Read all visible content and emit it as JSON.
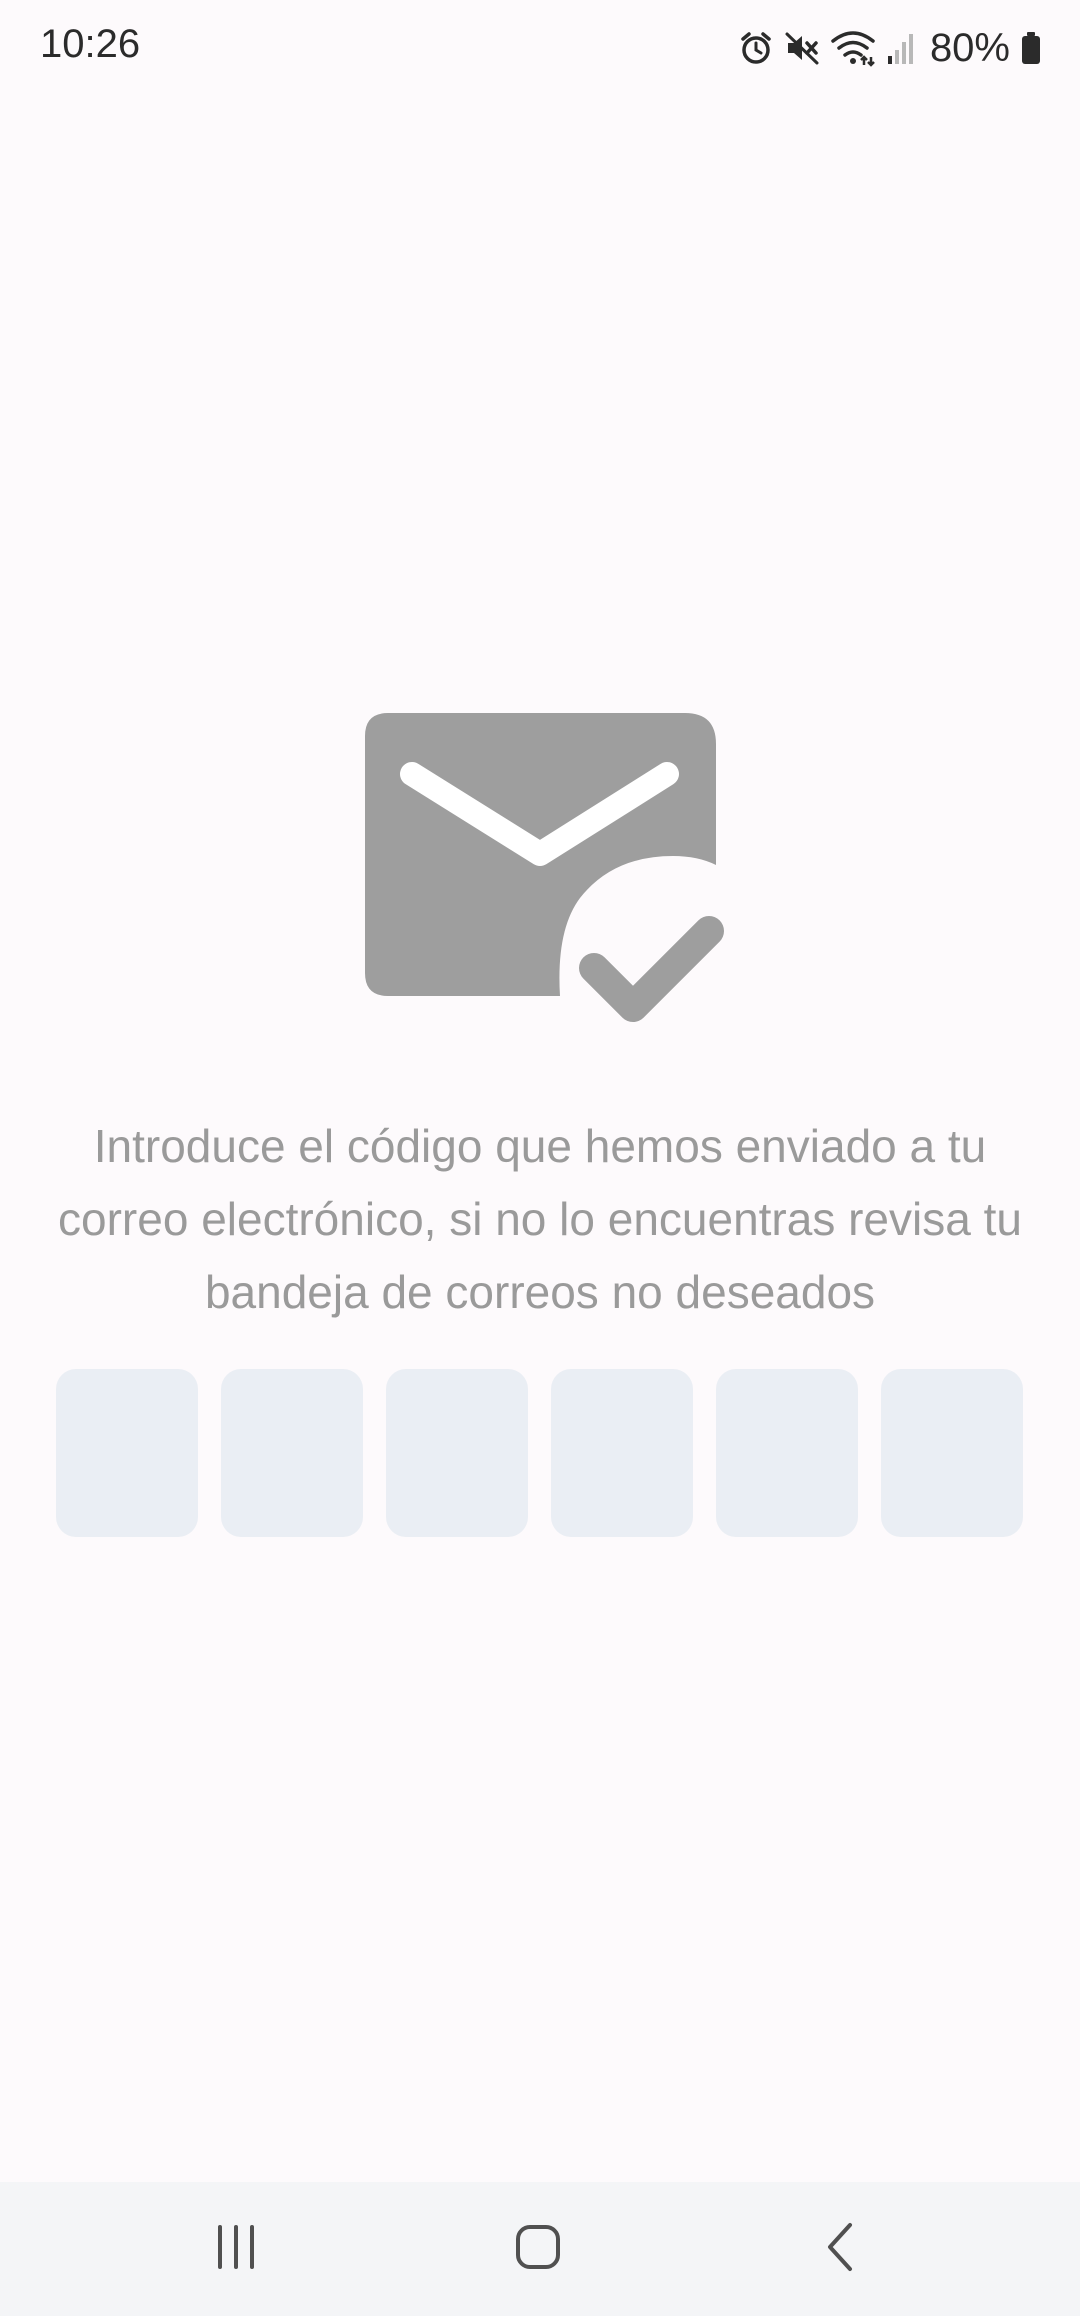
{
  "status_bar": {
    "time": "10:26",
    "battery": "80%",
    "icons": [
      "alarm-icon",
      "mute-icon",
      "wifi-icon",
      "signal-icon",
      "battery-icon"
    ]
  },
  "main": {
    "icon": "mail-check-icon",
    "instructions": "Introduce el código que hemos enviado a tu correo electrónico, si no lo encuentras revisa tu bandeja de correos no deseados",
    "code_inputs": [
      "",
      "",
      "",
      "",
      "",
      ""
    ]
  },
  "nav_bar": {
    "buttons": [
      "recent-apps-icon",
      "home-icon",
      "back-icon"
    ]
  },
  "colors": {
    "background": "#fdfafc",
    "icon_gray": "#9e9e9e",
    "text_gray": "#9a9a9a",
    "input_bg": "#eaeef4",
    "nav_bg": "#f4f5f7"
  }
}
